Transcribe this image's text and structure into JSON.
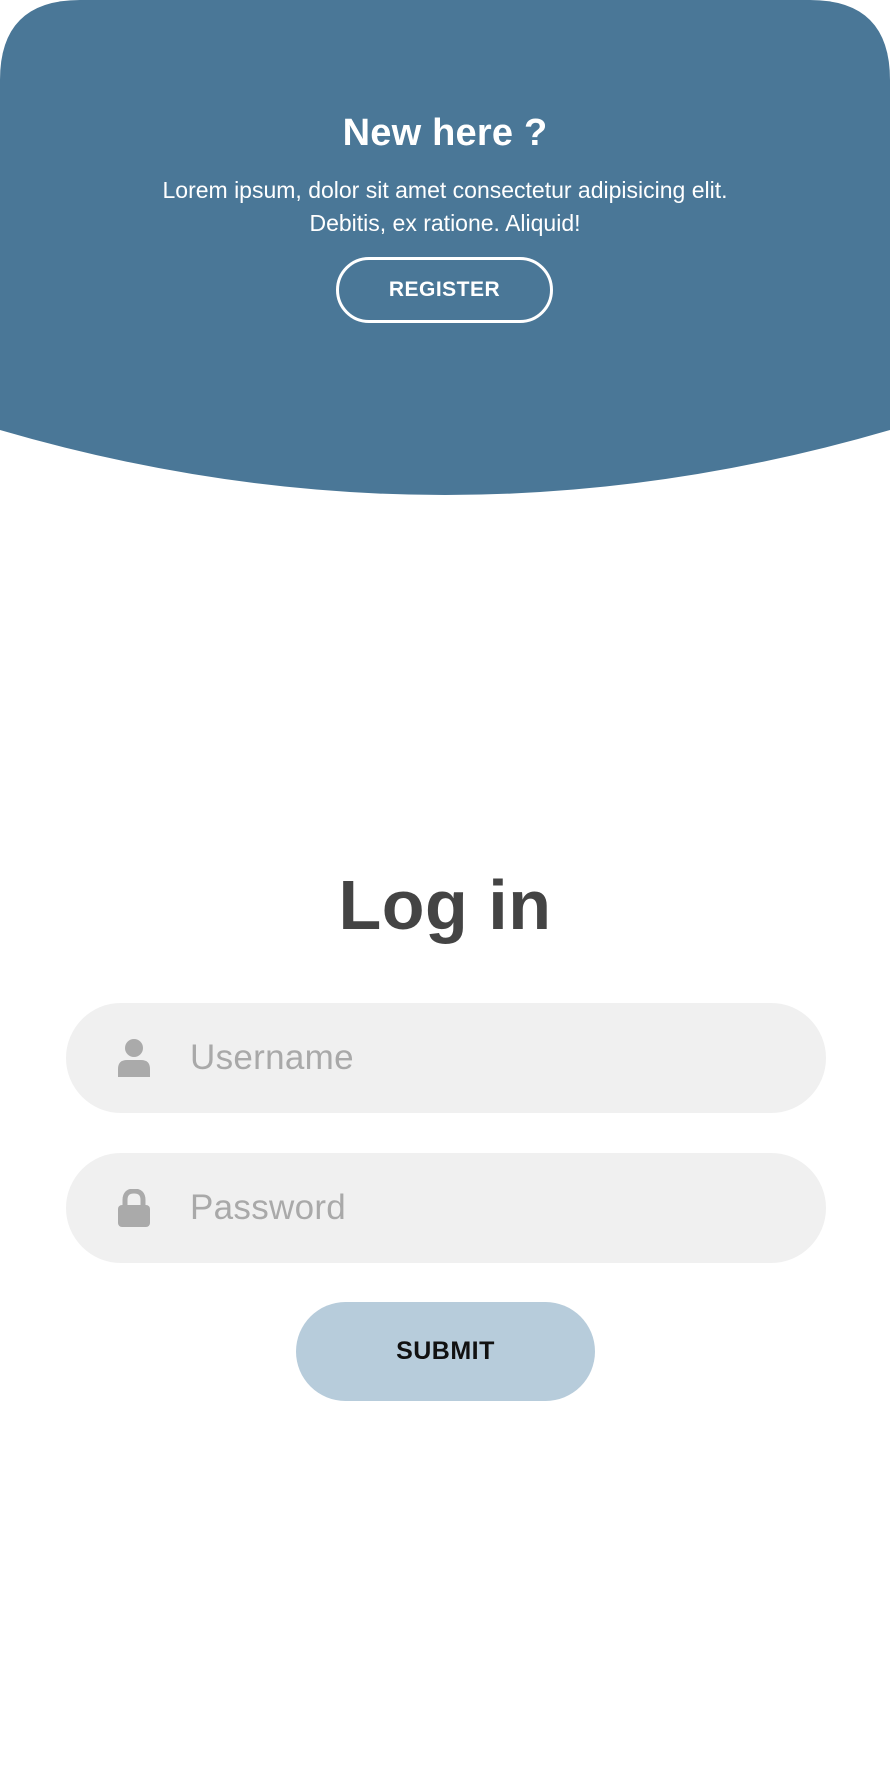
{
  "colors": {
    "hero_background": "#4a7797",
    "hero_text": "#ffffff",
    "login_title": "#444444",
    "field_background": "#f0f0f0",
    "placeholder_text": "#a9a9a9",
    "icon": "#aaaaaa",
    "submit_background": "#b7ccdb",
    "submit_text": "#111111"
  },
  "hero": {
    "title": "New here ?",
    "text_line1": "Lorem ipsum, dolor sit amet consectetur adipisicing elit.",
    "text_line2": "Debitis, ex ratione. Aliquid!",
    "register_label": "REGISTER"
  },
  "login": {
    "title": "Log in",
    "username": {
      "icon": "user-icon",
      "placeholder": "Username",
      "value": ""
    },
    "password": {
      "icon": "lock-icon",
      "placeholder": "Password",
      "value": ""
    },
    "submit_label": "SUBMIT"
  }
}
